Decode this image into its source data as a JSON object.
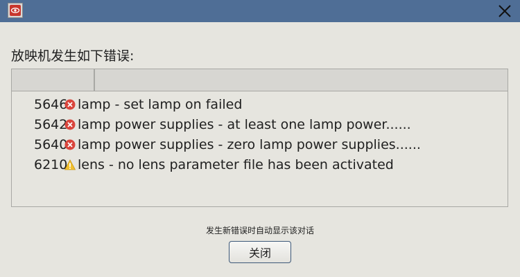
{
  "dialog": {
    "prompt": "放映机发生如下错误:",
    "errors": [
      {
        "code": "5646",
        "severity": "error",
        "message": "lamp - set lamp on failed"
      },
      {
        "code": "5642",
        "severity": "error",
        "message": "lamp power supplies - at least one lamp power......"
      },
      {
        "code": "5640",
        "severity": "error",
        "message": "lamp power supplies - zero lamp power supplies......"
      },
      {
        "code": "6210",
        "severity": "warning",
        "message": "lens - no lens parameter file has been activated"
      }
    ],
    "status_text": "发生新错误时自动显示该对话",
    "close_button_label": "关闭"
  },
  "icons": {
    "app": "projector-app-icon",
    "close": "close-icon",
    "error": "error-icon",
    "warning": "warning-icon"
  },
  "colors": {
    "titlebar": "#4f6e96",
    "background": "#e6e5df",
    "error": "#d9453c",
    "warning": "#f2c12e"
  }
}
